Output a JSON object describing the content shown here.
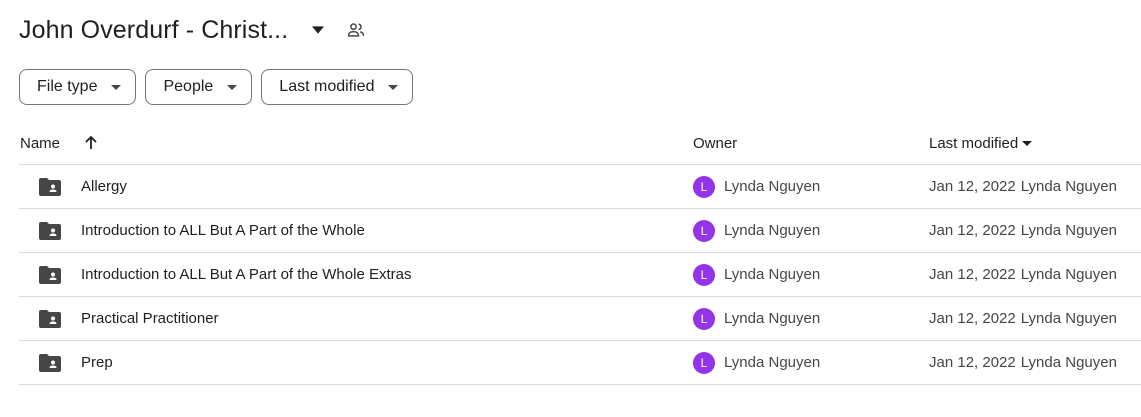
{
  "header": {
    "title": "John Overdurf - Christ...",
    "caret_icon": "arrow-drop-down-icon",
    "shared_icon": "people-icon"
  },
  "filters": [
    {
      "label": "File type"
    },
    {
      "label": "People"
    },
    {
      "label": "Last modified"
    }
  ],
  "table": {
    "columns": {
      "name": "Name",
      "owner": "Owner",
      "modified": "Last modified"
    },
    "rows": [
      {
        "name": "Allergy",
        "avatar": "L",
        "owner": "Lynda Nguyen",
        "date": "Jan 12, 2022",
        "modified_by": "Lynda Nguyen"
      },
      {
        "name": "Introduction to ALL But A Part of the Whole",
        "avatar": "L",
        "owner": "Lynda Nguyen",
        "date": "Jan 12, 2022",
        "modified_by": "Lynda Nguyen"
      },
      {
        "name": "Introduction to ALL But A Part of the Whole Extras",
        "avatar": "L",
        "owner": "Lynda Nguyen",
        "date": "Jan 12, 2022",
        "modified_by": "Lynda Nguyen"
      },
      {
        "name": "Practical Practitioner",
        "avatar": "L",
        "owner": "Lynda Nguyen",
        "date": "Jan 12, 2022",
        "modified_by": "Lynda Nguyen"
      },
      {
        "name": "Prep",
        "avatar": "L",
        "owner": "Lynda Nguyen",
        "date": "Jan 12, 2022",
        "modified_by": "Lynda Nguyen"
      }
    ]
  },
  "colors": {
    "avatar": "#9334e6",
    "folder": "#444746",
    "divider": "#dadce0"
  }
}
